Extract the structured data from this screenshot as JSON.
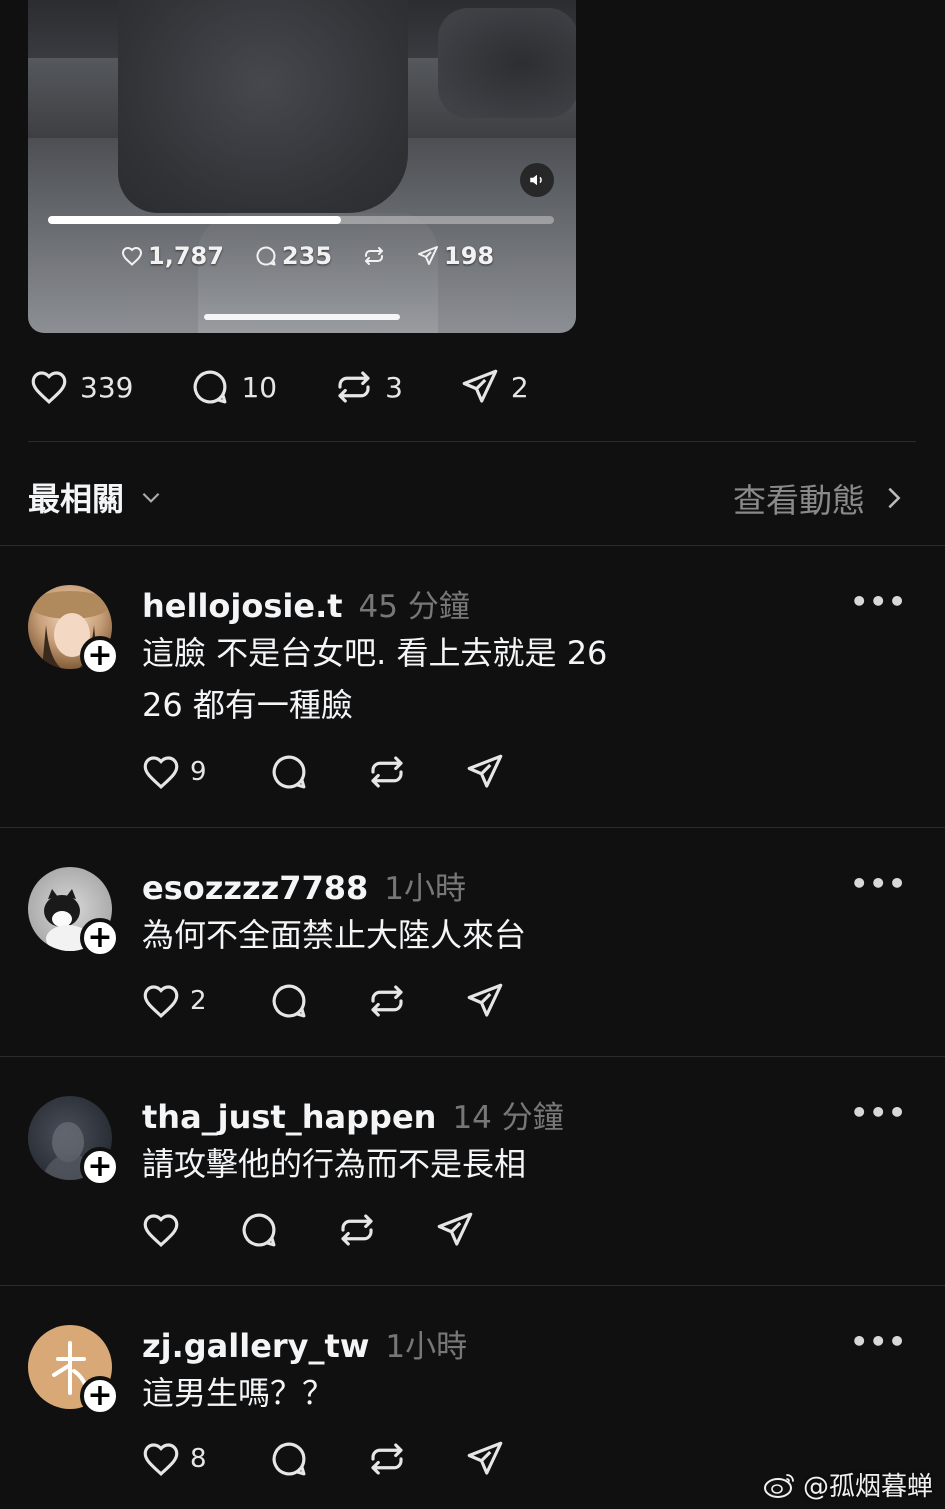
{
  "video": {
    "progress_fraction": 0.58,
    "likes": "1,787",
    "comments": "235",
    "shares": "198"
  },
  "post_stats": {
    "likes": "339",
    "comments": "10",
    "reposts": "3",
    "shares": "2"
  },
  "sort": {
    "label": "最相關",
    "view_activity": "查看動態"
  },
  "comments": [
    {
      "username": "hellojosie.t",
      "time": "45 分鐘",
      "text_line1": "這臉 不是台女吧. 看上去就是 26",
      "text_line2": "26 都有一種臉",
      "likes": "9"
    },
    {
      "username": "esozzzz7788",
      "time": "1小時",
      "text_line1": "為何不全面禁止大陸人來台",
      "likes": "2"
    },
    {
      "username": "tha_just_happen",
      "time": "14 分鐘",
      "text_line1": "請攻擊他的行為而不是長相",
      "likes": ""
    },
    {
      "username": "zj.gallery_tw",
      "time": "1小時",
      "text_line1": "這男生嗎？？",
      "likes": "8"
    }
  ],
  "watermark": "@孤烟暮蝉",
  "colors": {
    "background": "#101010",
    "text": "#f3f5f7",
    "muted": "#777777",
    "divider": "#2b2b2b"
  }
}
